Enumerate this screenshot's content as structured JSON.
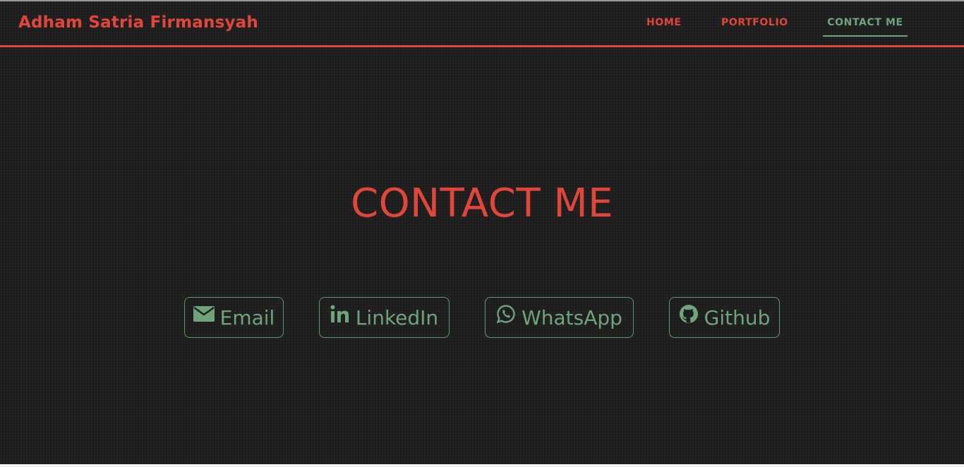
{
  "header": {
    "brand": "Adham Satria Firmansyah",
    "nav": [
      {
        "label": "HOME",
        "active": false
      },
      {
        "label": "PORTFOLIO",
        "active": false
      },
      {
        "label": "CONTACT ME",
        "active": true
      }
    ]
  },
  "main": {
    "title": "CONTACT ME",
    "contacts": [
      {
        "label": "Email",
        "icon": "envelope-icon"
      },
      {
        "label": "LinkedIn",
        "icon": "linkedin-icon"
      },
      {
        "label": "WhatsApp",
        "icon": "whatsapp-icon"
      },
      {
        "label": "Github",
        "icon": "github-icon"
      }
    ]
  },
  "colors": {
    "accent_red": "#e2463b",
    "accent_green": "#6fa37a",
    "background": "#1e1e1f"
  }
}
